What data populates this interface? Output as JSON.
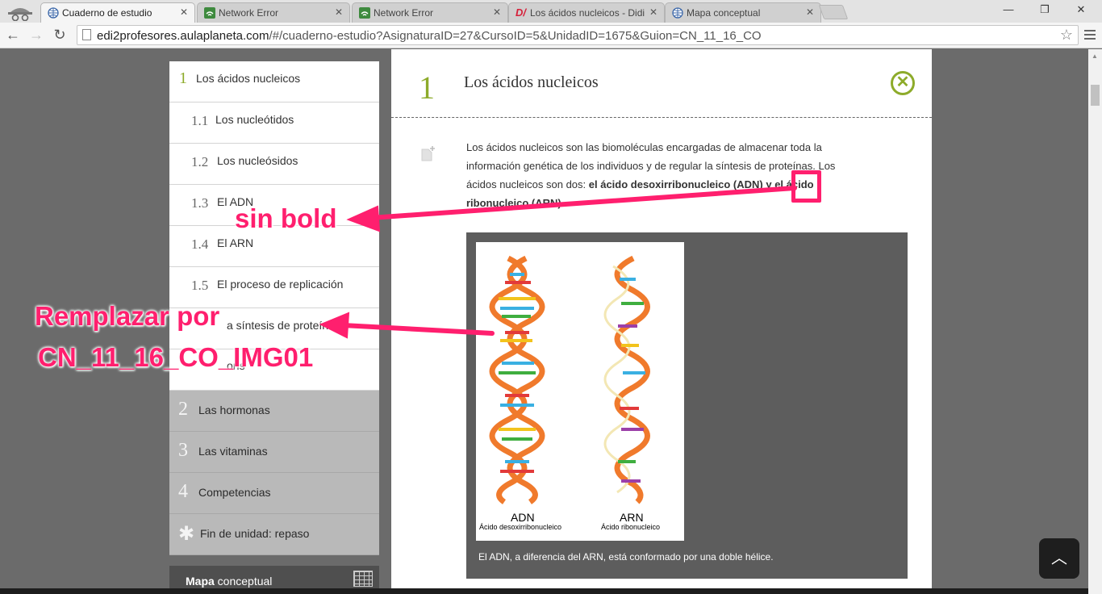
{
  "browser": {
    "tabs": [
      {
        "label": "Cuaderno de estudio",
        "icon": "globe-icon",
        "active": true
      },
      {
        "label": "Network Error",
        "icon": "network-error-icon"
      },
      {
        "label": "Network Error",
        "icon": "network-error-icon"
      },
      {
        "label": "Los ácidos nucleicos - Didi",
        "icon": "didi-d-icon"
      },
      {
        "label": "Mapa conceptual",
        "icon": "globe-icon"
      }
    ],
    "url_host": "edi2profesores.aulaplaneta.com",
    "url_path": "/#/cuaderno-estudio?AsignaturaID=27&CursoID=5&UnidadID=1675&Guion=CN_11_16_CO"
  },
  "sidebar": {
    "items": [
      {
        "num": "1",
        "label": "Los ácidos nucleicos"
      },
      {
        "num": "1.1",
        "label": "Los nucleótidos"
      },
      {
        "num": "1.2",
        "label": "Los nucleósidos"
      },
      {
        "num": "1.3",
        "label": "El ADN"
      },
      {
        "num": "1.4",
        "label": "El ARN"
      },
      {
        "num": "1.5",
        "label": "El proceso de replicación"
      },
      {
        "num": "",
        "label": "a síntesis de proteín"
      },
      {
        "num": "",
        "label": "ons"
      }
    ],
    "sections": [
      {
        "num": "2",
        "label": "Las hormonas"
      },
      {
        "num": "3",
        "label": "Las vitaminas"
      },
      {
        "num": "4",
        "label": "Competencias"
      },
      {
        "num": "✱",
        "label": "Fin de unidad: repaso"
      }
    ],
    "mapa_bold": "Mapa",
    "mapa_rest": " conceptual"
  },
  "content": {
    "num": "1",
    "title": "Los ácidos nucleicos",
    "para_start": "Los ácidos nucleicos son las biomoléculas encargadas de almacenar toda la información genética de los individuos y de regular la síntesis de proteínas. Los ácidos nucleicos son dos: ",
    "para_bold": "el ácido desoxirribonucleico (ADN) y el ácido ribonucleico (ARN)",
    "para_end": ".",
    "figure": {
      "label_adn": "ADN",
      "sub_adn": "Ácido desoxirribonucleico",
      "label_arn": "ARN",
      "sub_arn": "Ácido ribonucleico",
      "caption": "El ADN, a diferencia del ARN, está conformado por una doble hélice."
    }
  },
  "annotations": {
    "sin_bold": "sin bold",
    "remplazar": "Remplazar por",
    "img_code": "CN_11_16_CO_IMG01",
    "color": "#ff1f6e"
  }
}
